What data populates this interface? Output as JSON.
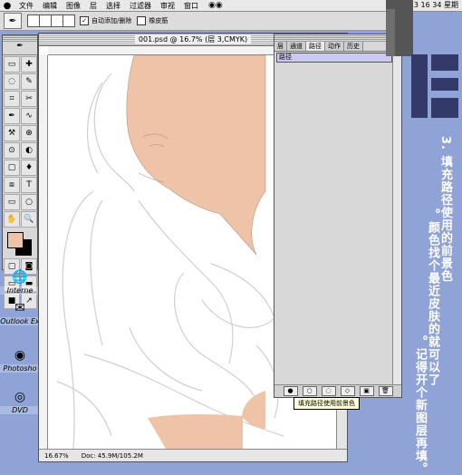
{
  "menubar": {
    "apple": "",
    "items": [
      "文件",
      "编辑",
      "图像",
      "层",
      "选择",
      "过滤器",
      "审视",
      "窗口"
    ],
    "clock": "13 16 34 星期"
  },
  "options": {
    "auto_add_label": "自动添加/删除",
    "rubber_band_label": "橡皮筋"
  },
  "toolbox": {
    "tools": [
      "▭",
      "✚",
      "◌",
      "✎",
      "⌗",
      "✂",
      "✒",
      "∿",
      "⚒",
      "⊕",
      "⊙",
      "◐",
      "▢",
      "♦",
      "⧈",
      "T",
      "▭",
      "○",
      "✋",
      "🔍"
    ],
    "fg_color": "#eec3a8",
    "bg_color": "#000000"
  },
  "desktop": {
    "icons": [
      {
        "label": "Interne",
        "icon": "globe-icon"
      },
      {
        "label": "Outlook Ex",
        "icon": "mail-icon"
      },
      {
        "label": "Photosho",
        "icon": "eye-icon"
      },
      {
        "label": "DVD",
        "icon": "dvd-icon"
      }
    ]
  },
  "document": {
    "title": "001.psd @ 16.7% (层 3,CMYK)",
    "zoom": "16.67%",
    "doc_size": "Doc: 45.9M/105.2M"
  },
  "panel": {
    "tabs": [
      "层",
      "通道",
      "路径",
      "动作",
      "历史"
    ],
    "active_tab": "路径",
    "path_row": "路径",
    "tooltip": "填充路径使用前景色"
  },
  "sidebar_text": {
    "col1": "3. 填充路径使用的前景色",
    "col2": "。颜色找个最近皮肤的就可以了",
    "col3": "。记得开个新图层再填。"
  }
}
